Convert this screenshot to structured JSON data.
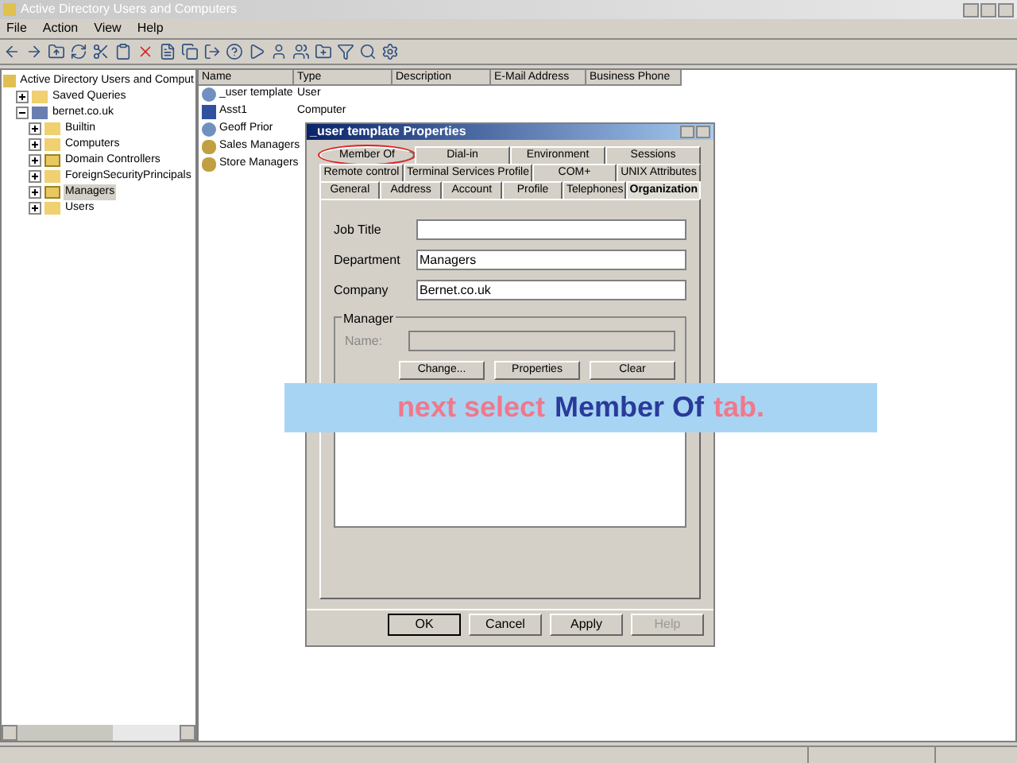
{
  "window": {
    "title": "Active Directory Users and Computers"
  },
  "menu": [
    "File",
    "Action",
    "View",
    "Help"
  ],
  "tree": {
    "label": "Active Directory Users and Comput",
    "selected": false,
    "children": [
      {
        "label": "Saved Queries",
        "kind": "folder",
        "expanded": false,
        "selected": false
      },
      {
        "label": "bernet.co.uk",
        "kind": "domain",
        "expanded": true,
        "selected": false,
        "children": [
          {
            "label": "Builtin",
            "kind": "folder",
            "expanded": false,
            "selected": false
          },
          {
            "label": "Computers",
            "kind": "folder",
            "expanded": false,
            "selected": false
          },
          {
            "label": "Domain Controllers",
            "kind": "ou",
            "expanded": false,
            "selected": false
          },
          {
            "label": "ForeignSecurityPrincipals",
            "kind": "folder",
            "expanded": false,
            "selected": false
          },
          {
            "label": "Managers",
            "kind": "ou",
            "expanded": false,
            "selected": true
          },
          {
            "label": "Users",
            "kind": "folder",
            "expanded": false,
            "selected": false
          }
        ]
      }
    ]
  },
  "list": {
    "columns": [
      "Name",
      "Type",
      "Description",
      "E-Mail Address",
      "Business Phone"
    ],
    "rows": [
      {
        "name": "_user template",
        "type": "User",
        "kind": "user"
      },
      {
        "name": "Asst1",
        "type": "Computer",
        "kind": "computer"
      },
      {
        "name": "Geoff Prior",
        "kind": "user"
      },
      {
        "name": "Sales Managers",
        "kind": "group"
      },
      {
        "name": "Store Managers",
        "kind": "group"
      }
    ]
  },
  "dialog": {
    "title": "_user template Properties",
    "tab_rows": [
      [
        {
          "label": "Member Of",
          "selected": false,
          "circled": true
        },
        {
          "label": "Dial-in",
          "selected": false,
          "circled": false
        },
        {
          "label": "Environment",
          "selected": false,
          "circled": false
        },
        {
          "label": "Sessions",
          "selected": false,
          "circled": false
        }
      ],
      [
        {
          "label": "Remote control",
          "selected": false,
          "circled": false
        },
        {
          "label": "Terminal Services Profile",
          "selected": false,
          "circled": false
        },
        {
          "label": "COM+",
          "selected": false,
          "circled": false
        },
        {
          "label": "UNIX Attributes",
          "selected": false,
          "circled": false
        }
      ],
      [
        {
          "label": "General",
          "selected": false,
          "circled": false
        },
        {
          "label": "Address",
          "selected": false,
          "circled": false
        },
        {
          "label": "Account",
          "selected": false,
          "circled": false
        },
        {
          "label": "Profile",
          "selected": false,
          "circled": false
        },
        {
          "label": "Telephones",
          "selected": false,
          "circled": false
        },
        {
          "label": "Organization",
          "selected": true,
          "circled": false
        }
      ]
    ],
    "fields": [
      {
        "label": "Job Title"
      },
      {
        "label": "Department",
        "value": "Managers"
      },
      {
        "label": "Company",
        "value": "Bernet.co.uk"
      }
    ],
    "manager": {
      "title": "Manager",
      "name_label": "Name:",
      "buttons": [
        "Change...",
        "Properties",
        "Clear"
      ]
    },
    "buttons": [
      {
        "label": "OK",
        "disabled": false,
        "default": true
      },
      {
        "label": "Cancel",
        "disabled": false,
        "default": false
      },
      {
        "label": "Apply",
        "disabled": false,
        "default": false
      },
      {
        "label": "Help",
        "disabled": true,
        "default": false
      }
    ]
  },
  "banner": [
    {
      "text": "next select",
      "color": "#f0788a"
    },
    {
      "text": "Member Of",
      "color": "#2a3a9a"
    },
    {
      "text": "tab.",
      "color": "#f0788a"
    }
  ]
}
